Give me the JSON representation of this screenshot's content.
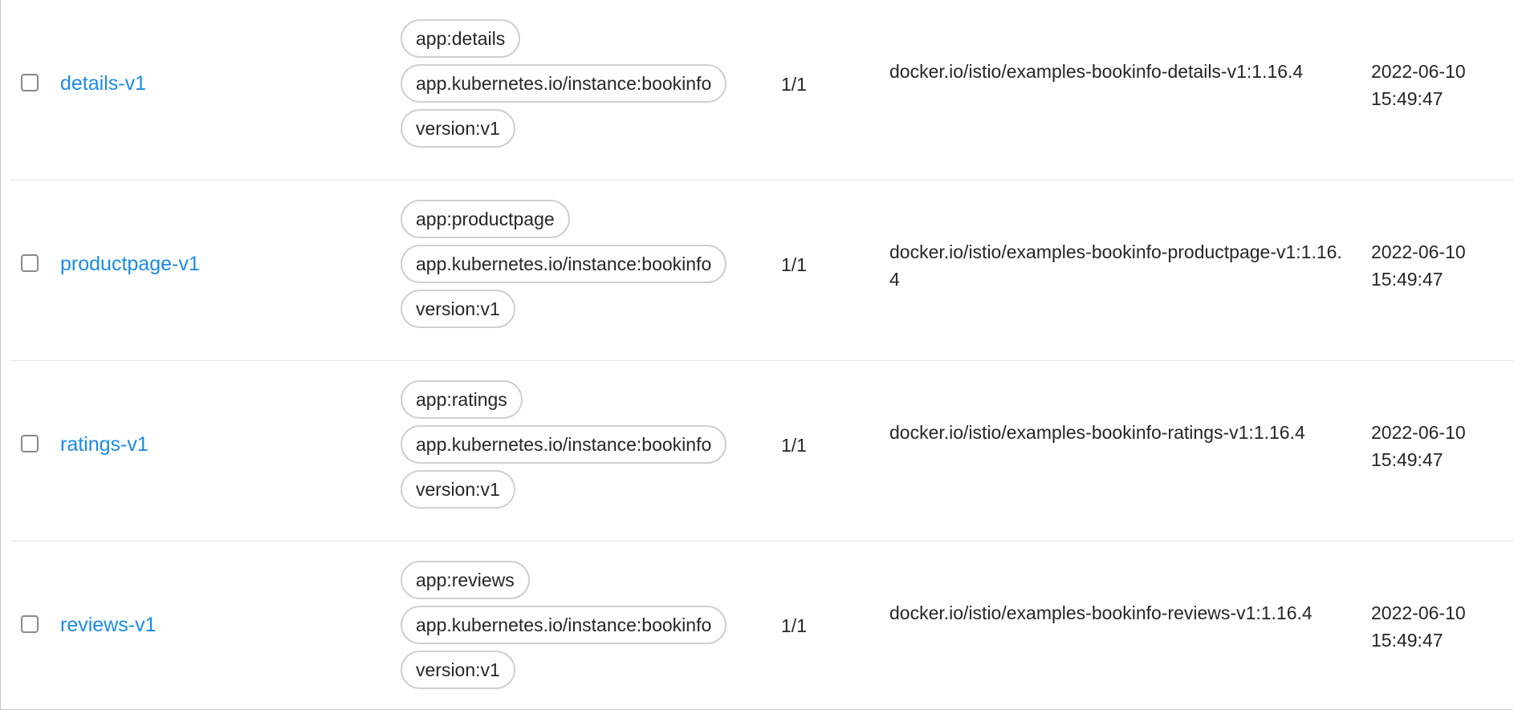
{
  "rows": [
    {
      "name": "details-v1",
      "labels": [
        "app:details",
        "app.kubernetes.io/instance:bookinfo",
        "version:v1"
      ],
      "replicas": "1/1",
      "image": "docker.io/istio/examples-bookinfo-details-v1:1.16.4",
      "created_date": "2022-06-10",
      "created_time": "15:49:47"
    },
    {
      "name": "productpage-v1",
      "labels": [
        "app:productpage",
        "app.kubernetes.io/instance:bookinfo",
        "version:v1"
      ],
      "replicas": "1/1",
      "image": "docker.io/istio/examples-bookinfo-productpage-v1:1.16.4",
      "created_date": "2022-06-10",
      "created_time": "15:49:47"
    },
    {
      "name": "ratings-v1",
      "labels": [
        "app:ratings",
        "app.kubernetes.io/instance:bookinfo",
        "version:v1"
      ],
      "replicas": "1/1",
      "image": "docker.io/istio/examples-bookinfo-ratings-v1:1.16.4",
      "created_date": "2022-06-10",
      "created_time": "15:49:47"
    },
    {
      "name": "reviews-v1",
      "labels": [
        "app:reviews",
        "app.kubernetes.io/instance:bookinfo",
        "version:v1"
      ],
      "replicas": "1/1",
      "image": "docker.io/istio/examples-bookinfo-reviews-v1:1.16.4",
      "created_date": "2022-06-10",
      "created_time": "15:49:47"
    }
  ],
  "colors": {
    "link": "#1a8bea",
    "text": "#262626",
    "tag_border": "#cfcfcf",
    "row_divider": "#e6e6e6"
  }
}
